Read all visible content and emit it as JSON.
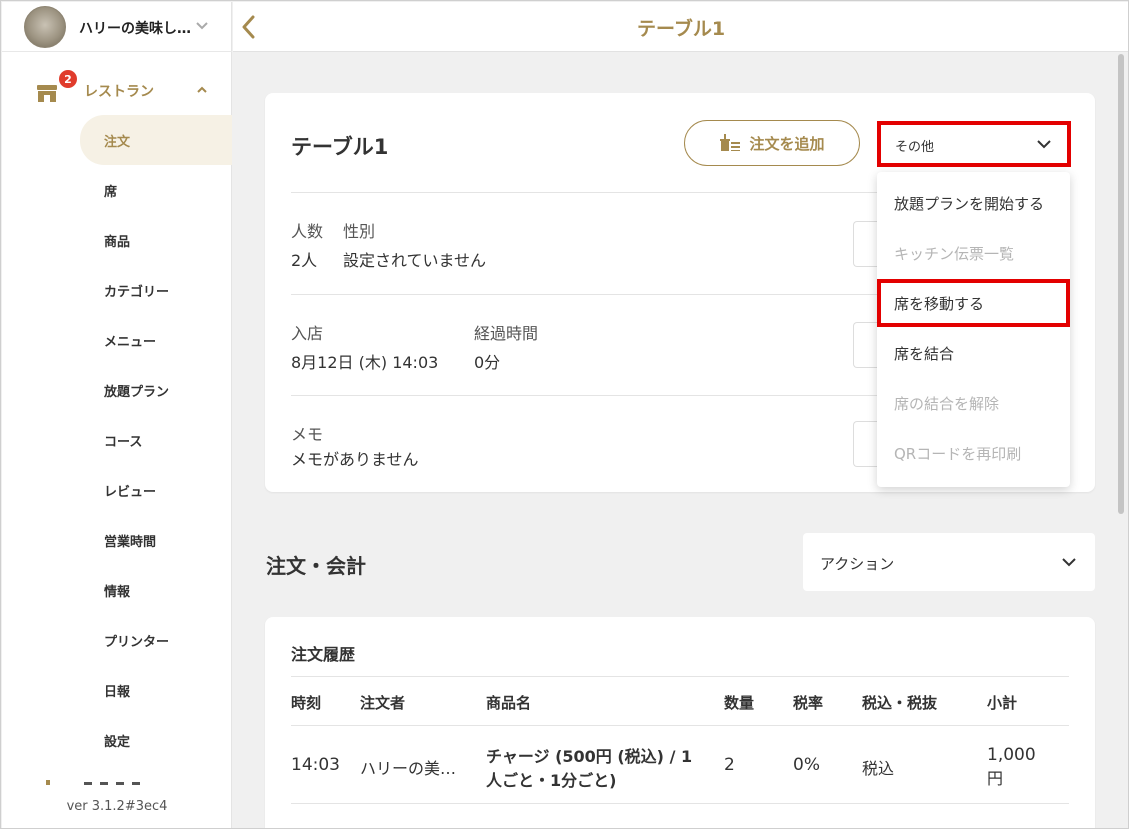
{
  "sidebar": {
    "store_name": "ハリーの美味し…",
    "restaurant_label": "レストラン",
    "restaurant_badge": "2",
    "items": [
      {
        "label": "注文",
        "active": true
      },
      {
        "label": "席"
      },
      {
        "label": "商品"
      },
      {
        "label": "カテゴリー"
      },
      {
        "label": "メニュー"
      },
      {
        "label": "放題プラン"
      },
      {
        "label": "コース"
      },
      {
        "label": "レビュー"
      },
      {
        "label": "営業時間"
      },
      {
        "label": "情報"
      },
      {
        "label": "プリンター"
      },
      {
        "label": "日報"
      },
      {
        "label": "設定"
      }
    ],
    "version": "ver 3.1.2#3ec4"
  },
  "topbar": {
    "title": "テーブル1",
    "back_icon": "chevron-left-icon"
  },
  "table_card": {
    "title": "テーブル1",
    "add_order_label": "注文を追加",
    "other_label": "その他",
    "people_label": "人数",
    "gender_label": "性別",
    "people_value": "2人",
    "gender_value": "設定されていません",
    "entry_label": "入店",
    "elapsed_label": "経過時間",
    "entry_value": "8月12日 (木) 14:03",
    "elapsed_value": "0分",
    "memo_label": "メモ",
    "memo_value": "メモがありません"
  },
  "other_menu": {
    "items": [
      {
        "label": "放題プランを開始する",
        "disabled": false
      },
      {
        "label": "キッチン伝票一覧",
        "disabled": true
      },
      {
        "label": "席を移動する",
        "disabled": false,
        "highlighted": true
      },
      {
        "label": "席を結合",
        "disabled": false
      },
      {
        "label": "席の結合を解除",
        "disabled": true
      },
      {
        "label": "QRコードを再印刷",
        "disabled": true
      }
    ]
  },
  "orders_section": {
    "title": "注文・会計",
    "action_label": "アクション",
    "history_title": "注文履歴",
    "columns": [
      "時刻",
      "注文者",
      "商品名",
      "数量",
      "税率",
      "税込・税抜",
      "小計"
    ],
    "rows": [
      {
        "time": "14:03",
        "orderer": "ハリーの美…",
        "product_line1": "チャージ (500円 (税込) / 1",
        "product_line2": "人ごと・1分ごと)",
        "quantity": "2",
        "tax_rate": "0%",
        "tax_type": "税込",
        "subtotal_line1": "1,000",
        "subtotal_line2": "円"
      }
    ]
  },
  "colors": {
    "brand_gold": "#a58a4e",
    "highlight_red": "#e30000",
    "badge_red": "#e03c2c",
    "background": "#f0f0f0"
  }
}
